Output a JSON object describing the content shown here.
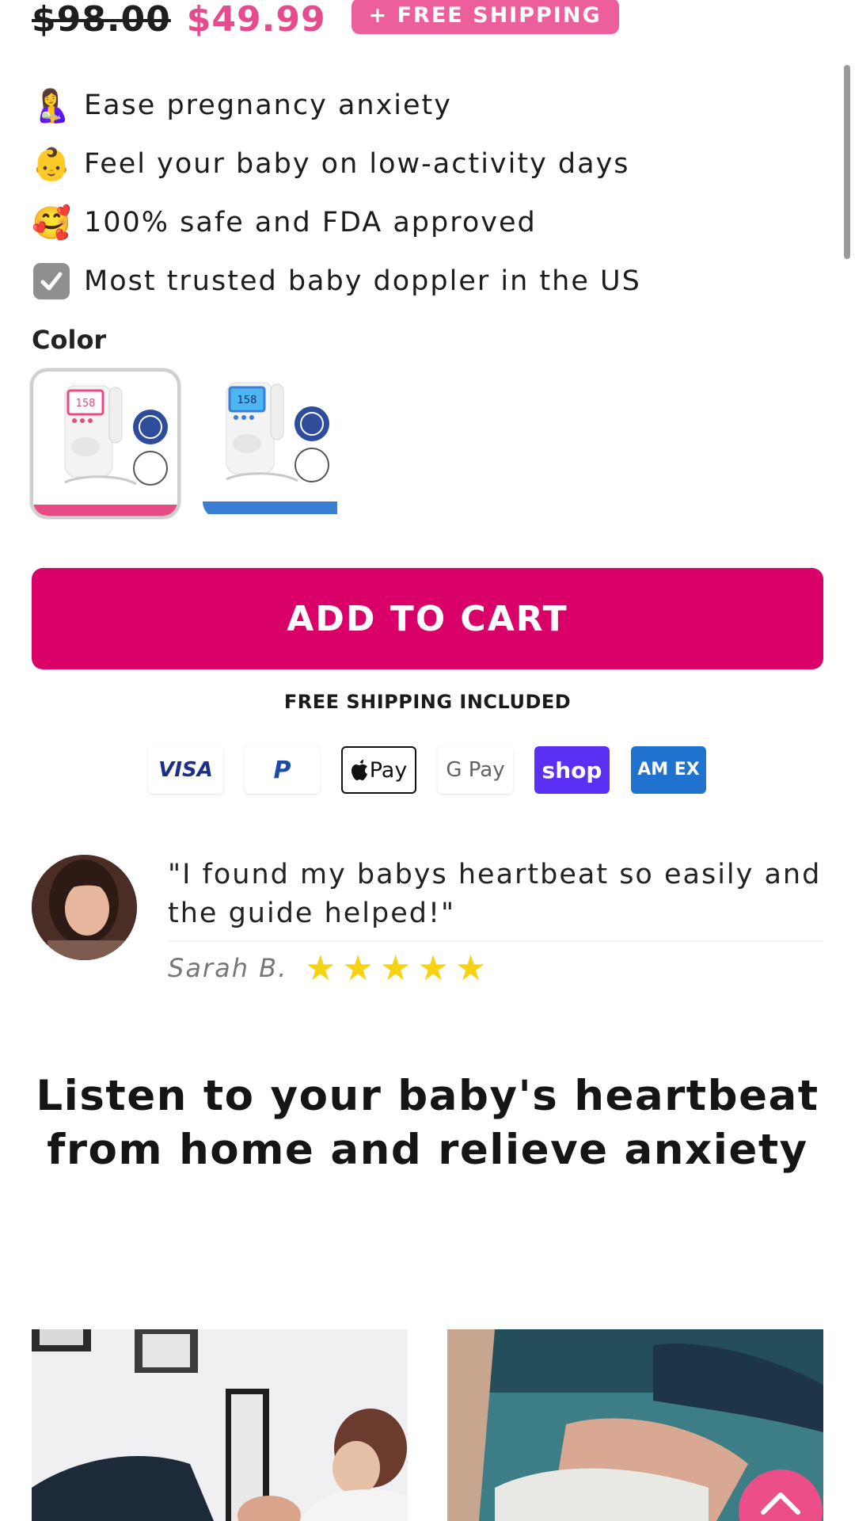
{
  "pricing": {
    "old_price": "$98.00",
    "new_price": "$49.99",
    "shipping_badge": "+ FREE SHIPPING"
  },
  "benefits": [
    {
      "icon": "mother-baby-emoji",
      "emoji": "🤱",
      "text": "Ease pregnancy anxiety"
    },
    {
      "icon": "baby-face-emoji",
      "emoji": "👶",
      "text": "Feel your baby on low-activity days"
    },
    {
      "icon": "smiling-hearts-emoji",
      "emoji": "🥰",
      "text": "100% safe and FDA approved"
    },
    {
      "icon": "check-box-emoji",
      "emoji": "✔",
      "text": "Most trusted baby doppler in the US"
    }
  ],
  "color_selector": {
    "label": "Color",
    "options": [
      {
        "name": "pink",
        "accent": "#e84a84",
        "screen": "158",
        "selected": true
      },
      {
        "name": "blue",
        "accent": "#3a7fd5",
        "screen": "158",
        "selected": false
      }
    ]
  },
  "cart": {
    "button_label": "ADD TO CART",
    "note": "FREE SHIPPING INCLUDED"
  },
  "payments": [
    "VISA",
    "P",
    "Pay",
    "G Pay",
    "shop",
    "AM EX"
  ],
  "review": {
    "quote": "\"I found my babys heartbeat so easily and the guide helped!\"",
    "author": "Sarah B.",
    "rating": 5
  },
  "headline": "Listen to your baby's heartbeat from home and relieve anxiety",
  "colors": {
    "brand_pink": "#d90068",
    "price_pink": "#e54b8d",
    "badge_pink": "#ec5f9a",
    "star_yellow": "#f5d213"
  }
}
